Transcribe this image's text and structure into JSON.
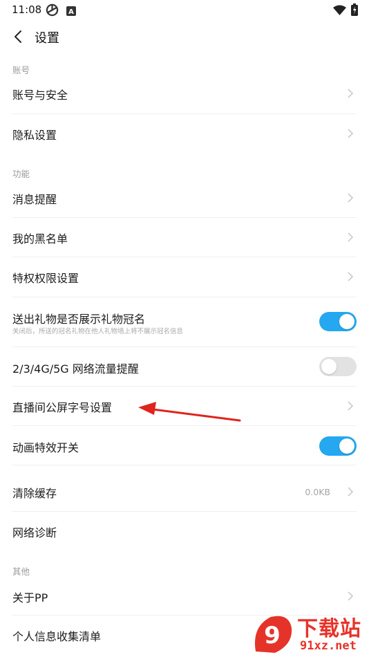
{
  "status_bar": {
    "time": "11:08",
    "notif_letter": "A"
  },
  "header": {
    "title": "设置"
  },
  "sections": {
    "account": "账号",
    "function": "功能",
    "other": "其他"
  },
  "rows": {
    "account_security": {
      "label": "账号与安全"
    },
    "privacy": {
      "label": "隐私设置"
    },
    "notifications": {
      "label": "消息提醒"
    },
    "blacklist": {
      "label": "我的黑名单"
    },
    "privilege": {
      "label": "特权权限设置"
    },
    "gift_title": {
      "label": "送出礼物是否展示礼物冠名",
      "subtitle": "关闭后，所送的冠名礼物在他人礼物墙上将不展示冠名信息",
      "enabled": true
    },
    "network_traffic": {
      "label": "2/3/4G/5G 网络流量提醒",
      "enabled": false
    },
    "font_size": {
      "label": "直播间公屏字号设置"
    },
    "animation": {
      "label": "动画特效开关",
      "enabled": true
    },
    "clear_cache": {
      "label": "清除缓存",
      "value": "0.0KB"
    },
    "network_diag": {
      "label": "网络诊断"
    },
    "about": {
      "label": "关于PP"
    },
    "personal_info": {
      "label": "个人信息收集清单"
    }
  },
  "watermark": {
    "title": "下载站",
    "url": "91xz.net",
    "badge": "9"
  },
  "colors": {
    "accent": "#25a8f0",
    "toggle_off": "#e2e2e2",
    "annotation": "#e0231c",
    "watermark": "#e6332a"
  }
}
